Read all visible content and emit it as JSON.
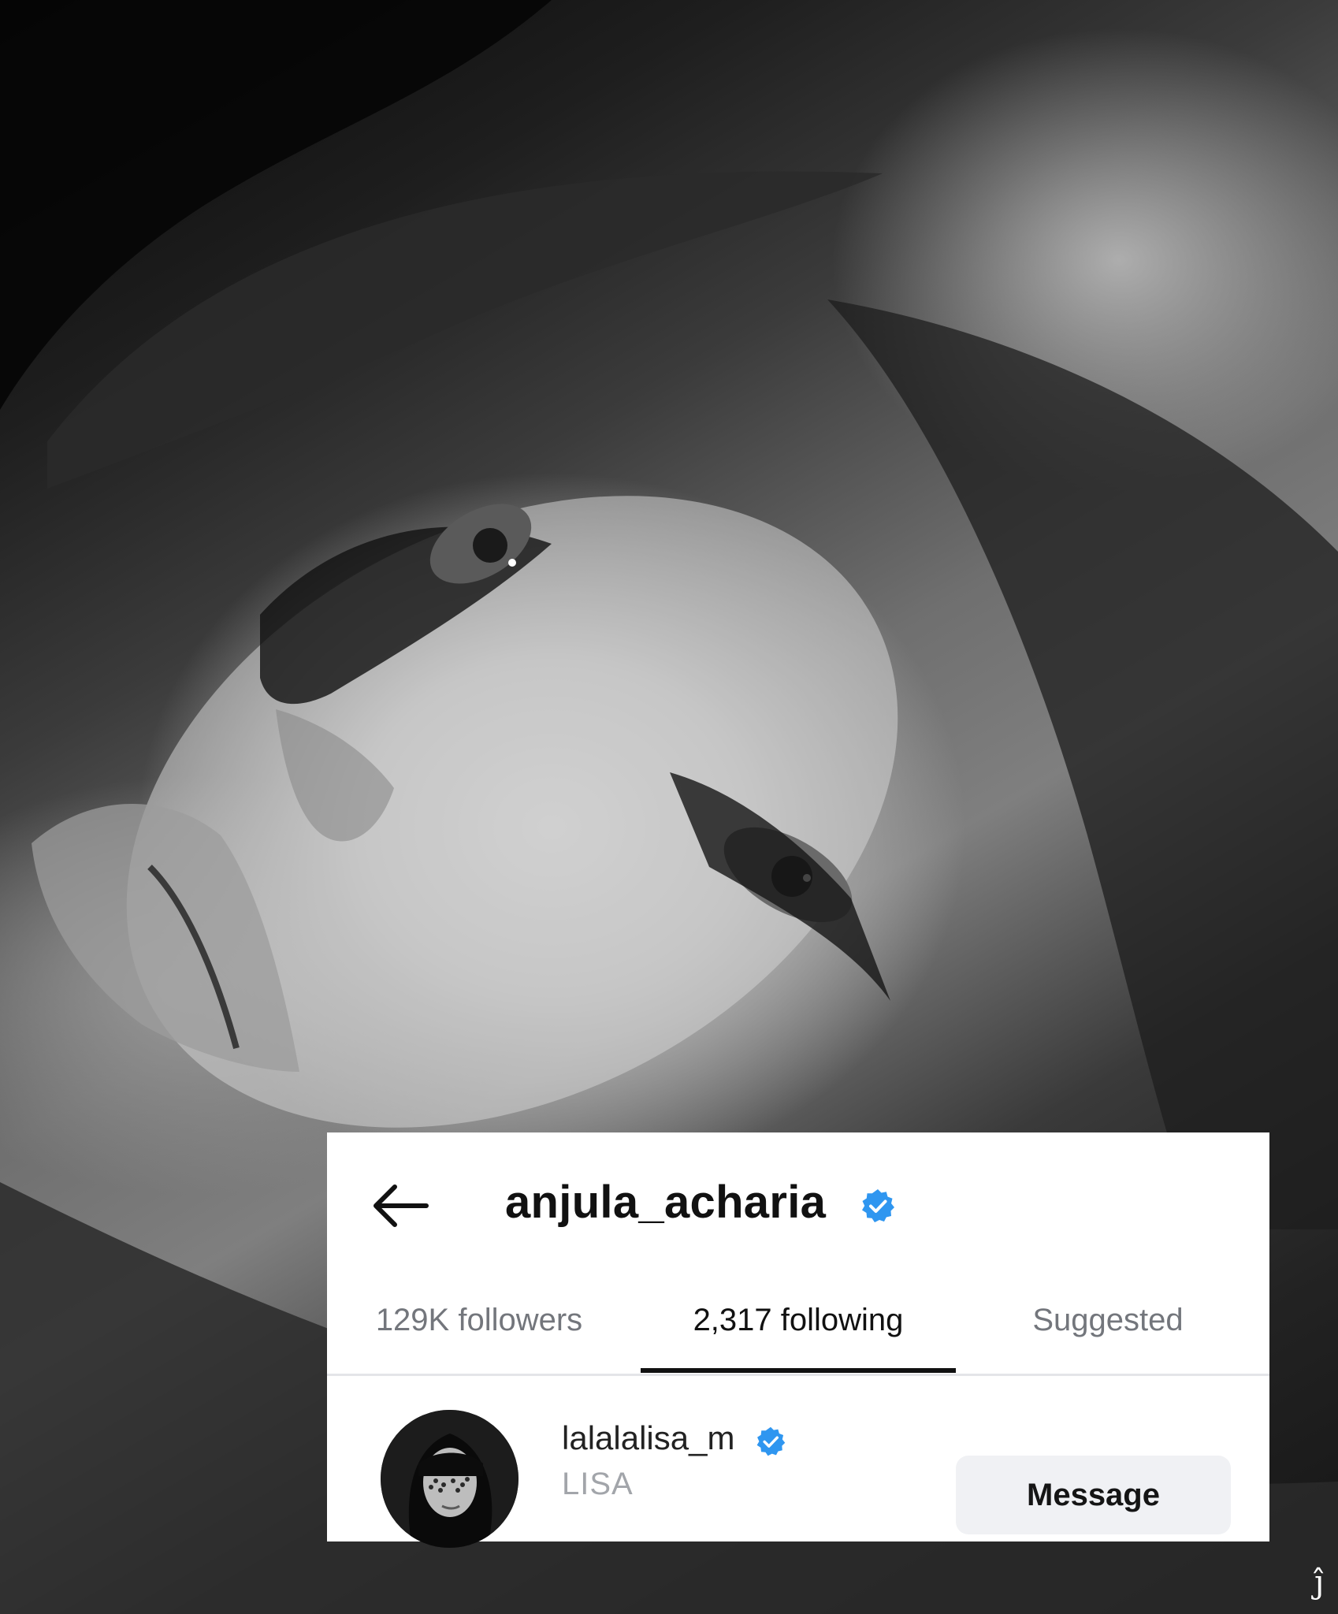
{
  "header": {
    "back_icon": "arrow-left-icon",
    "profile_name": "anjula_acharia",
    "verified_icon": "verified-badge-icon",
    "verified_color": "#2f96f0"
  },
  "tabs": [
    {
      "label": "129K followers",
      "active": false
    },
    {
      "label": "2,317 following",
      "active": true
    },
    {
      "label": "Suggested",
      "active": false
    }
  ],
  "following_list": [
    {
      "username": "lalalalisa_m",
      "display_name": "LISA",
      "verified": true,
      "action_label": "Message"
    }
  ],
  "colors": {
    "card_background": "#ffffff",
    "inactive_tab_text": "#73767c",
    "active_tab_text": "#111111",
    "button_background": "#f0f1f4"
  }
}
